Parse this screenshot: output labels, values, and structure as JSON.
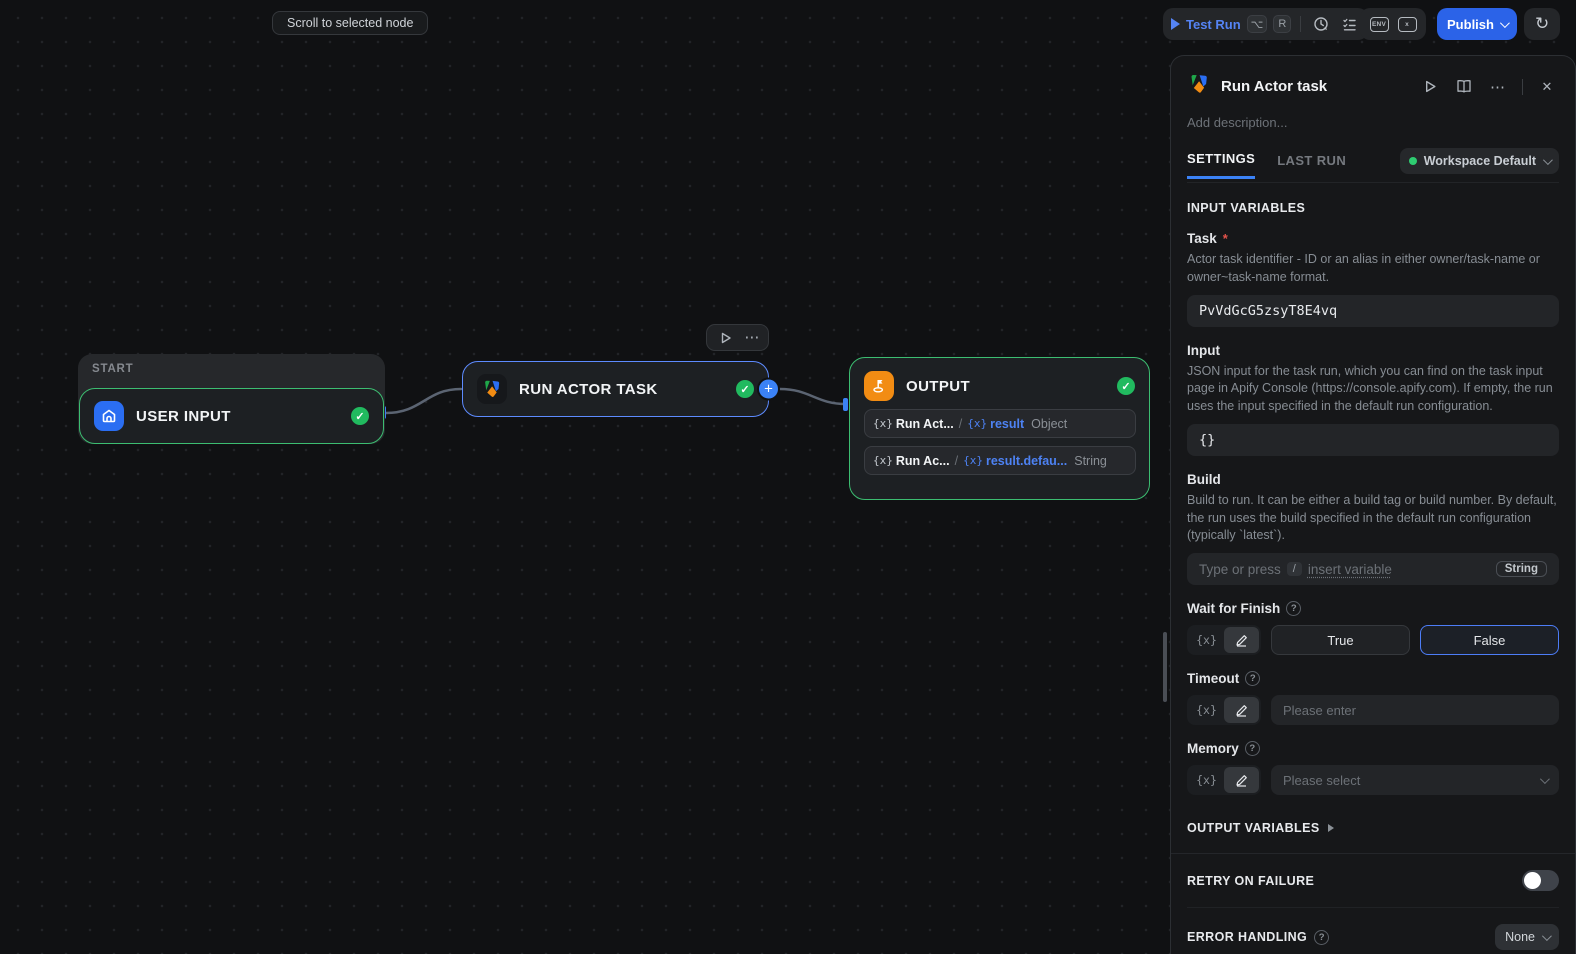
{
  "toolbar": {
    "test_run_label": "Test Run",
    "shortcut_keys": {
      "modifier": "⌥",
      "key": "R"
    },
    "env_icon_label": "ENV",
    "var_icon_label": "x",
    "publish_label": "Publish"
  },
  "canvas": {
    "tooltip": "Scroll to selected node",
    "start_group_label": "START",
    "nodes": {
      "user_input": {
        "title": "USER INPUT"
      },
      "run_actor_task": {
        "title": "RUN ACTOR TASK"
      },
      "output": {
        "title": "OUTPUT",
        "variables": [
          {
            "x": "{x}",
            "source": "Run Act...",
            "slash": "/",
            "x2": "{x}",
            "path": "result",
            "type": "Object"
          },
          {
            "x": "{x}",
            "source": "Run Ac...",
            "slash": "/",
            "x2": "{x}",
            "path": "result.defau...",
            "type": "String"
          }
        ]
      }
    }
  },
  "panel": {
    "title": "Run Actor task",
    "description_placeholder": "Add description...",
    "tabs": {
      "settings": "SETTINGS",
      "last_run": "LAST RUN"
    },
    "workspace_label": "Workspace Default",
    "input_variables_heading": "INPUT VARIABLES",
    "task": {
      "label": "Task",
      "required_mark": "*",
      "description": "Actor task identifier - ID or an alias in either owner/task-name or owner~task-name format.",
      "value": "PvVdGcG5zsyT8E4vq"
    },
    "input": {
      "label": "Input",
      "description": "JSON input for the task run, which you can find on the task input page in Apify Console (https://console.apify.com). If empty, the run uses the input specified in the default run configuration.",
      "value": "{}"
    },
    "build": {
      "label": "Build",
      "description": "Build to run. It can be either a build tag or build number. By default, the run uses the build specified in the default run configuration (typically `latest`).",
      "placeholder_prefix": "Type or press",
      "placeholder_key": "/",
      "placeholder_suffix": "insert variable",
      "type_badge": "String"
    },
    "wait_for_finish": {
      "label": "Wait for Finish",
      "var_toggle": "{x}",
      "true_label": "True",
      "false_label": "False"
    },
    "timeout": {
      "label": "Timeout",
      "var_toggle": "{x}",
      "placeholder": "Please enter"
    },
    "memory": {
      "label": "Memory",
      "var_toggle": "{x}",
      "placeholder": "Please select"
    },
    "output_variables_heading": "OUTPUT VARIABLES",
    "retry_heading": "RETRY ON FAILURE",
    "error_heading": "ERROR HANDLING",
    "error_value": "None"
  },
  "colors": {
    "accent_blue": "#3b82f6",
    "selected_border": "#5d8bff",
    "success_green": "#21ba5f",
    "node_green_border": "#3cbd71",
    "apify_orange": "#f28c13",
    "apify_green": "#1fa74a",
    "apify_blue": "#2b6ef2",
    "publish_blue": "#2b63e8",
    "panel_bg": "#161719",
    "canvas_bg": "#101113"
  }
}
